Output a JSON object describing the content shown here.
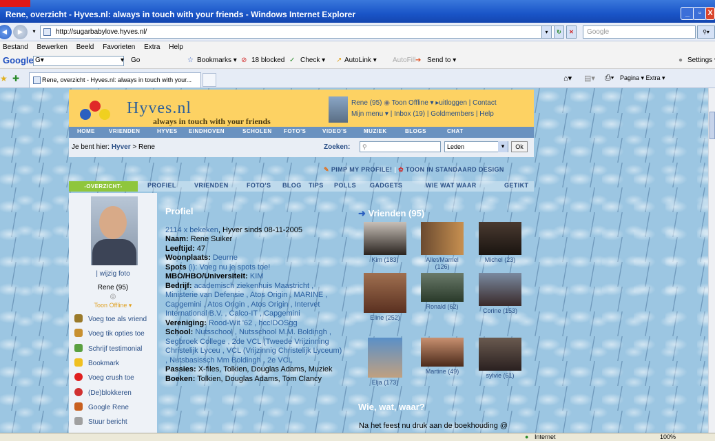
{
  "window": {
    "title": "Rene, overzicht - Hyves.nl: always in touch with your friends - Windows Internet Explorer",
    "minimize": "_",
    "maximize": "▫",
    "close": "X"
  },
  "address": {
    "url": "http://sugarbabylove.hyves.nl/",
    "search_placeholder": "Google"
  },
  "menu": [
    "Bestand",
    "Bewerken",
    "Beeld",
    "Favorieten",
    "Extra",
    "Help"
  ],
  "google_toolbar": {
    "label": "Google",
    "combo": "G▾",
    "go": "Go",
    "bookmarks": "Bookmarks ▾",
    "blocked": "18 blocked",
    "check": "Check ▾",
    "autolink": "AutoLink ▾",
    "autofill": "AutoFill",
    "sendto": "Send to ▾",
    "settings": "Settings ▾"
  },
  "tab": {
    "label": "Rene, overzicht - Hyves.nl: always in touch with your...",
    "tools": "Pagina ▾   Extra ▾"
  },
  "header": {
    "brand": "Hyves.nl",
    "tagline": "always in touch with your friends",
    "user_line1_name": "Rene (95)",
    "user_line1_status": "Toon Offline ▾",
    "user_line1_logout": "▸uitloggen",
    "user_line1_contact": "Contact",
    "user_line2_menu": "Mijn menu ▾",
    "user_line2_inbox": "Inbox (19)",
    "user_line2_gold": "Goldmembers",
    "user_line2_help": "Help"
  },
  "main_nav": [
    "HOME",
    "VRIENDEN",
    "HYVES",
    "EINDHOVEN",
    "SCHOLEN",
    "FOTO'S",
    "VIDEO'S",
    "MUZIEK",
    "BLOGS",
    "CHAT"
  ],
  "breadcrumb": {
    "prefix": "Je bent hier:",
    "link": "Hyver",
    "sep": ">",
    "current": "Rene"
  },
  "search": {
    "label": "Zoeken:",
    "input": "",
    "select": "Leden",
    "ok": "Ok"
  },
  "pimp": {
    "pimp_label": "PIMP MY PROFILE!",
    "standard_label": "TOON IN STANDAARD DESIGN"
  },
  "sub_nav": [
    "-OVERZICHT-",
    "PROFIEL",
    "VRIENDEN",
    "FOTO'S",
    "BLOG",
    "TIPS",
    "POLLS",
    "GADGETS",
    "WIE WAT WAAR",
    "GETIKT"
  ],
  "sidebar": {
    "edit_photo": "| wijzig foto",
    "name": "Rene (95)",
    "status": "Toon Offline ▾",
    "actions": [
      {
        "label": "Voeg toe als vriend",
        "color": "#9a7a2a"
      },
      {
        "label": "Voeg tik opties toe",
        "color": "#c89030"
      },
      {
        "label": "Schrijf testimonial",
        "color": "#5aa040"
      },
      {
        "label": "Bookmark",
        "color": "#f0c020"
      },
      {
        "label": "Voeg crush toe",
        "color": "#e02020"
      },
      {
        "label": "(De)blokkeren",
        "color": "#d03030"
      },
      {
        "label": "Google Rene",
        "color": "#c86020"
      },
      {
        "label": "Stuur bericht",
        "color": "#a0a0a0"
      }
    ]
  },
  "profile": {
    "heading": "Profiel",
    "views_link": "2114 x bekeken",
    "views_rest": ", Hyver sinds 08-11-2005",
    "naam_label": "Naam:",
    "naam": "Rene Suiker",
    "leeftijd_label": "Leeftijd:",
    "leeftijd": "47",
    "woonplaats_label": "Woonplaats:",
    "woonplaats": "Deurne",
    "spots_label": "Spots",
    "spots_info": "(i):",
    "spots": "Voeg nu je spots toe!",
    "school_hbo_label": "MBO/HBO/Universiteit:",
    "school_hbo": "KIM",
    "bedrijf_label": "Bedrijf:",
    "bedrijf": "academisch ziekenhuis Maastricht , Ministerie van Defensie , Atos Origin , MARINE , Capgemini , Atos Origin , Atos Origin , Intervet International B.V. , Calco-IT , Capgemini",
    "vereniging_label": "Vereniging:",
    "vereniging": "Rood-Wit '62 , hcc!DOSgg",
    "school_label": "School:",
    "school": "Nutsschool , Nutsschool M.M. Boldingh , Segbroek College , 2de VCL (Tweede Vrijzinning Christelijk Lyceu , VCL (Vrijzinnig Christelijk Lyceum) , Nutsbasissch Mm Boldingh , 2e VCL",
    "passies_label": "Passies:",
    "passies": "X-files, Tolkien, Douglas Adams, Muziek",
    "boeken_label": "Boeken:",
    "boeken": "Tolkien, Douglas Adams, Tom Clancy"
  },
  "friends": {
    "heading": "Vrienden (95)",
    "list": [
      {
        "name": "Kim (183)"
      },
      {
        "name": "Allet/Marriel (126)"
      },
      {
        "name": "Michel (23)"
      },
      {
        "name": "Eline (252)"
      },
      {
        "name": "Ronald (62)"
      },
      {
        "name": "Corine (153)"
      },
      {
        "name": "Elja (173)"
      },
      {
        "name": "Martine (49)"
      },
      {
        "name": "sylvie (61)"
      }
    ]
  },
  "wie_wat_waar": {
    "heading": "Wie, wat, waar?",
    "text": "Na het feest nu druk aan de boekhouding @"
  },
  "status": {
    "zone": "Internet",
    "zoom": "100%"
  }
}
